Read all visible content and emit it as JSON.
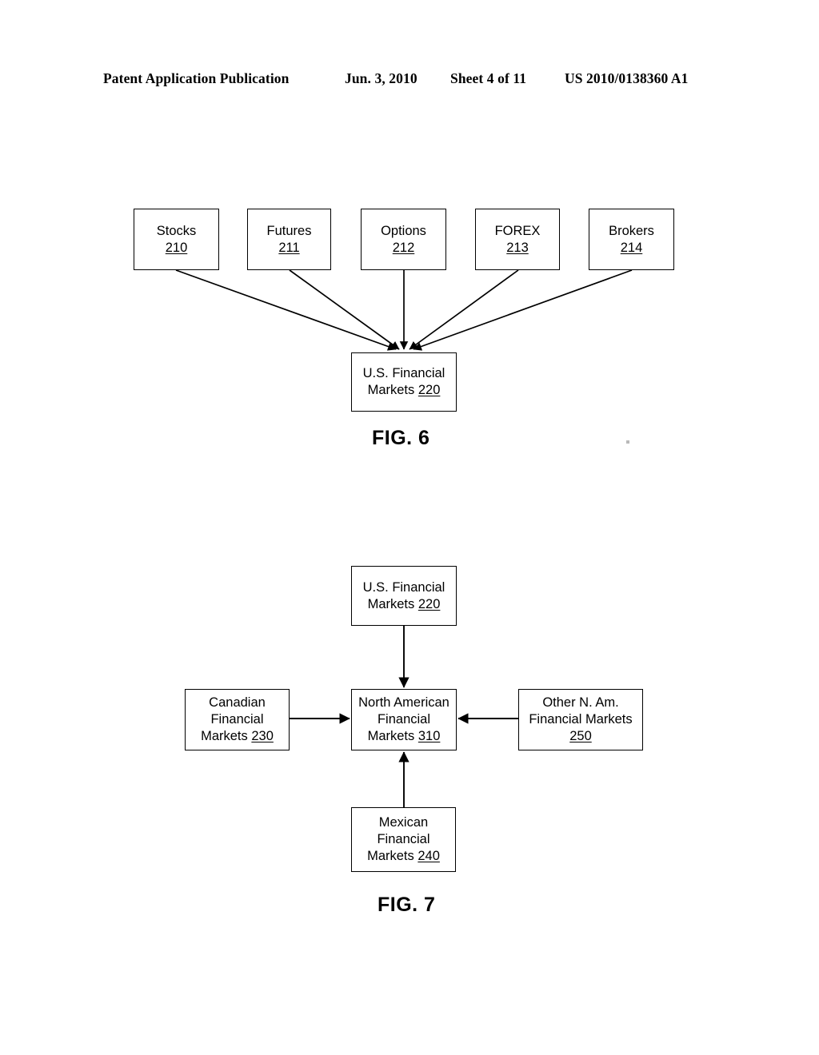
{
  "header": {
    "publication": "Patent Application Publication",
    "date": "Jun. 3, 2010",
    "sheet": "Sheet 4 of 11",
    "patent_number": "US 2010/0138360 A1"
  },
  "figures": [
    {
      "caption": "FIG. 6",
      "nodes": [
        {
          "id": "stocks",
          "line1": "Stocks",
          "ref": "210"
        },
        {
          "id": "futures",
          "line1": "Futures",
          "ref": "211"
        },
        {
          "id": "options",
          "line1": "Options",
          "ref": "212"
        },
        {
          "id": "forex",
          "line1": "FOREX",
          "ref": "213"
        },
        {
          "id": "brokers",
          "line1": "Brokers",
          "ref": "214"
        },
        {
          "id": "usfm",
          "line1": "U.S. Financial",
          "line2": "Markets ",
          "ref": "220"
        }
      ]
    },
    {
      "caption": "FIG. 7",
      "nodes": [
        {
          "id": "usfm",
          "line1": "U.S. Financial",
          "line2": "Markets ",
          "ref": "220"
        },
        {
          "id": "canadian",
          "line1": "Canadian",
          "line2": "Financial",
          "line3": "Markets  ",
          "ref": "230"
        },
        {
          "id": "nafm",
          "line1": "North American",
          "line2": "Financial",
          "line3": "Markets ",
          "ref": "310"
        },
        {
          "id": "othernam",
          "line1": "Other N. Am.",
          "line2": "Financial Markets",
          "ref": "250"
        },
        {
          "id": "mexican",
          "line1": "Mexican",
          "line2": "Financial",
          "line3": "Markets ",
          "ref": "240"
        }
      ]
    }
  ],
  "fig6_caption": "FIG. 6",
  "fig7_caption": "FIG. 7",
  "labels": {
    "stocks": {
      "text": "Stocks",
      "ref": "210"
    },
    "futures": {
      "text": "Futures",
      "ref": "211"
    },
    "options": {
      "text": "Options",
      "ref": "212"
    },
    "forex": {
      "text": "FOREX",
      "ref": "213"
    },
    "brokers": {
      "text": "Brokers",
      "ref": "214"
    },
    "usfm_l1": "U.S. Financial",
    "usfm_l2": "Markets ",
    "usfm_ref": "220",
    "canadian_l1": "Canadian",
    "canadian_l2": "Financial",
    "canadian_l3": "Markets  ",
    "canadian_ref": "230",
    "nafm_l1": "North American",
    "nafm_l2": "Financial",
    "nafm_l3": "Markets ",
    "nafm_ref": "310",
    "othernam_l1": "Other N. Am.",
    "othernam_l2": "Financial Markets",
    "othernam_ref": "250",
    "mexican_l1": "Mexican",
    "mexican_l2": "Financial",
    "mexican_l3": "Markets ",
    "mexican_ref": "240"
  },
  "colors": {
    "ink": "#000000",
    "page": "#ffffff"
  }
}
